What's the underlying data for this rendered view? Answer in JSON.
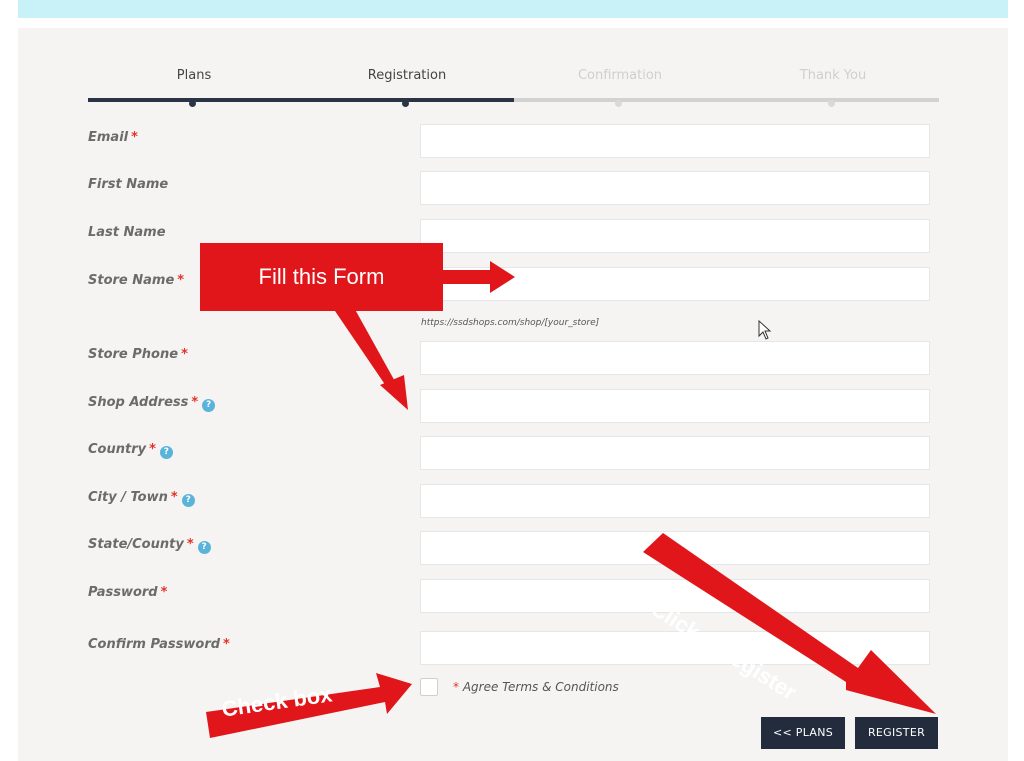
{
  "steps": [
    {
      "label": "Plans",
      "state": "done"
    },
    {
      "label": "Registration",
      "state": "done"
    },
    {
      "label": "Confirmation",
      "state": "todo"
    },
    {
      "label": "Thank You",
      "state": "todo"
    }
  ],
  "form": {
    "fields": [
      {
        "label": "Email",
        "required": true,
        "info": false,
        "value": ""
      },
      {
        "label": "First Name",
        "required": false,
        "info": false,
        "value": ""
      },
      {
        "label": "Last Name",
        "required": false,
        "info": false,
        "value": ""
      },
      {
        "label": "Store Name",
        "required": true,
        "info": false,
        "value": ""
      },
      {
        "label": "Store Phone",
        "required": true,
        "info": false,
        "value": ""
      },
      {
        "label": "Shop Address",
        "required": true,
        "info": true,
        "value": ""
      },
      {
        "label": "Country",
        "required": true,
        "info": true,
        "value": ""
      },
      {
        "label": "City / Town",
        "required": true,
        "info": true,
        "value": ""
      },
      {
        "label": "State/County",
        "required": true,
        "info": true,
        "value": ""
      },
      {
        "label": "Password",
        "required": true,
        "info": false,
        "value": ""
      },
      {
        "label": "Confirm Password",
        "required": true,
        "info": false,
        "value": ""
      }
    ],
    "store_url_hint": "https://ssdshops.com/shop/[your_store]",
    "required_mark": "*",
    "info_glyph": "?"
  },
  "agree": {
    "required_mark": "*",
    "label": "Agree  Terms & Conditions",
    "checked": false
  },
  "buttons": {
    "plans": "<< PLANS",
    "register": "REGISTER"
  },
  "annotations": {
    "fill_form": "Fill this Form",
    "check_box": "Check box",
    "click_register": "Click to register"
  },
  "colors": {
    "callout_red": "#e0161a",
    "button_dark": "#222c3c",
    "topbar": "#c8f2f8",
    "required": "#e4322b",
    "info_icon": "#5ab4d9"
  }
}
